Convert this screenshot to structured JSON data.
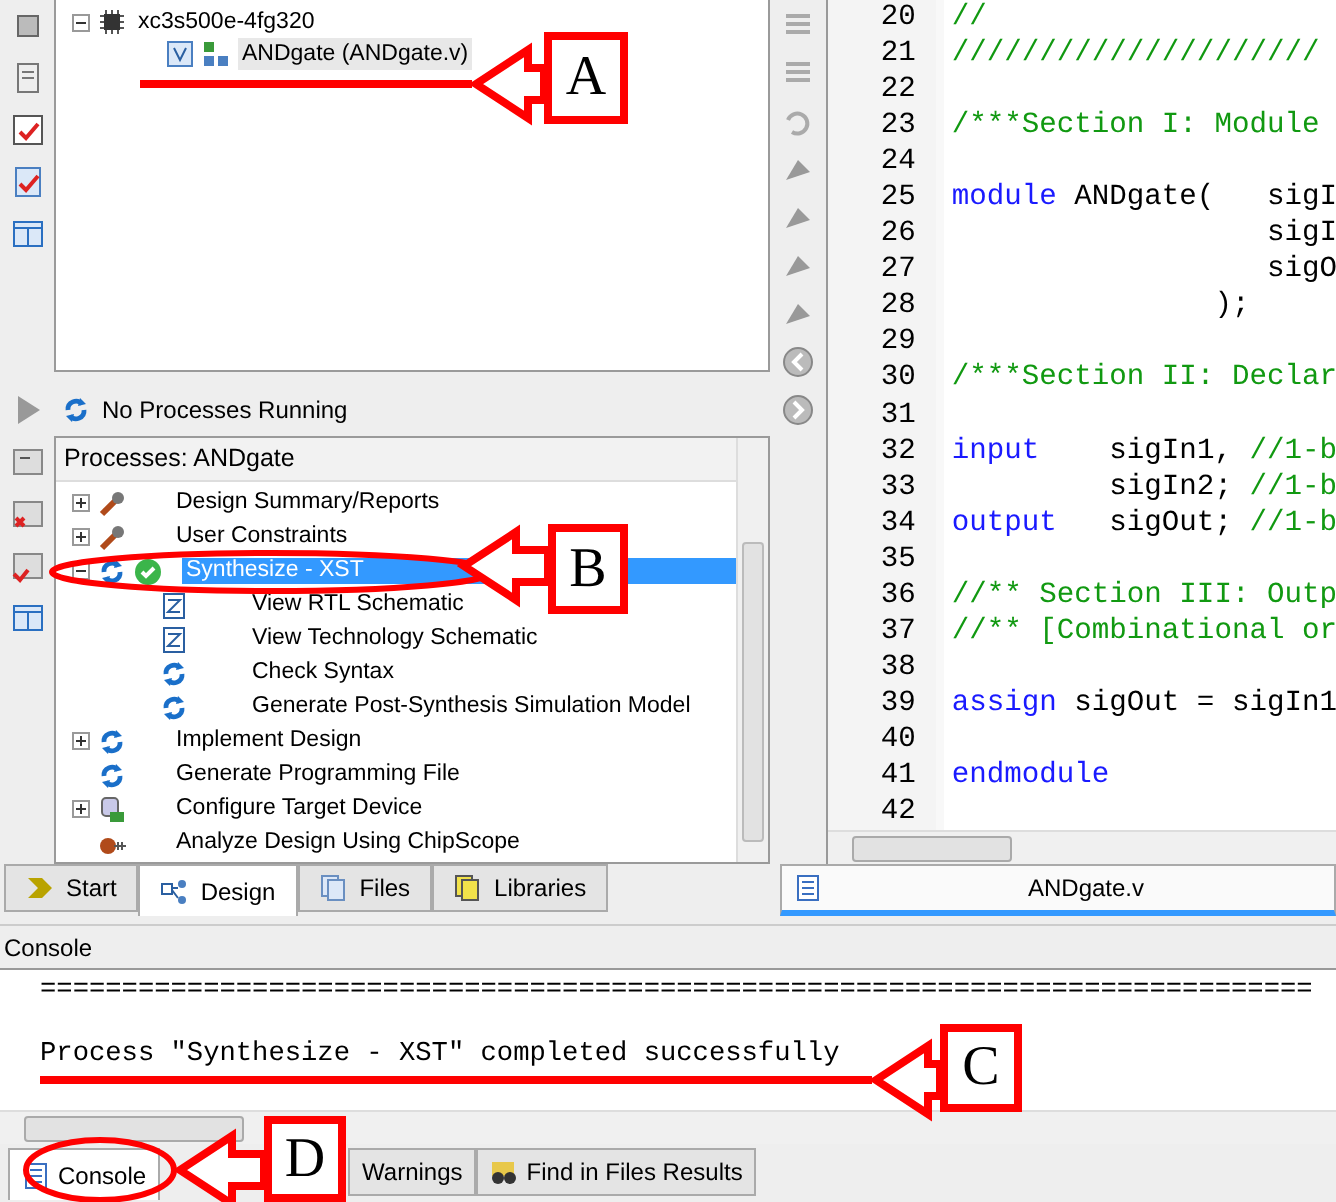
{
  "project_tree": [
    {
      "label": "xc3s500e-4fg320",
      "kind": "device",
      "expanded": true,
      "selected": false,
      "children": [
        {
          "label": "ANDgate (ANDgate.v)",
          "kind": "module",
          "selected": true
        }
      ]
    }
  ],
  "processes": {
    "status": "No Processes Running",
    "title": "Processes: ANDgate",
    "items": [
      {
        "label": "Design Summary/Reports",
        "kind": "tool",
        "expanded": false,
        "selected": false,
        "completed": false
      },
      {
        "label": "User Constraints",
        "kind": "tool",
        "expanded": false,
        "selected": false,
        "completed": false
      },
      {
        "label": "Synthesize - XST",
        "kind": "process",
        "expanded": true,
        "selected": true,
        "completed": true,
        "children": [
          {
            "label": "View RTL Schematic",
            "kind": "schematic",
            "selected": false
          },
          {
            "label": "View Technology Schematic",
            "kind": "schematic",
            "selected": false
          },
          {
            "label": "Check Syntax",
            "kind": "process",
            "selected": false
          },
          {
            "label": "Generate Post-Synthesis Simulation Model",
            "kind": "process",
            "selected": false
          }
        ]
      },
      {
        "label": "Implement Design",
        "kind": "process",
        "expanded": false,
        "selected": false,
        "completed": false
      },
      {
        "label": "Generate Programming File",
        "kind": "process",
        "selected": false,
        "completed": false
      },
      {
        "label": "Configure Target Device",
        "kind": "device",
        "expanded": false,
        "selected": false,
        "completed": false
      },
      {
        "label": "Analyze Design Using ChipScope",
        "kind": "probe",
        "selected": false,
        "completed": false
      }
    ]
  },
  "left_tabs": [
    {
      "label": "Start",
      "kind": "start",
      "selected": false
    },
    {
      "label": "Design",
      "kind": "design",
      "selected": true
    },
    {
      "label": "Files",
      "kind": "files",
      "selected": false
    },
    {
      "label": "Libraries",
      "kind": "libraries",
      "selected": false
    }
  ],
  "editor": {
    "lines": [
      {
        "number": "20",
        "tokens": [
          {
            "kind": "comment",
            "text": "//"
          }
        ]
      },
      {
        "number": "21",
        "tokens": [
          {
            "kind": "comment",
            "text": "/////////////////////"
          }
        ]
      },
      {
        "number": "22"
      },
      {
        "number": "23",
        "tokens": [
          {
            "kind": "comment",
            "text": "/***Section I: Module"
          }
        ]
      },
      {
        "number": "24"
      },
      {
        "number": "25",
        "tokens": [
          {
            "kind": "keyword",
            "text": "module"
          },
          {
            "kind": "plain",
            "text": " ANDgate(   sigI"
          }
        ]
      },
      {
        "number": "26",
        "tokens": [
          {
            "kind": "plain",
            "text": "                  sigI"
          }
        ]
      },
      {
        "number": "27",
        "tokens": [
          {
            "kind": "plain",
            "text": "                  sigO"
          }
        ]
      },
      {
        "number": "28",
        "tokens": [
          {
            "kind": "plain",
            "text": "               );"
          }
        ]
      },
      {
        "number": "29"
      },
      {
        "number": "30",
        "tokens": [
          {
            "kind": "comment",
            "text": "/***Section II: Declar"
          }
        ]
      },
      {
        "number": "31"
      },
      {
        "number": "32",
        "tokens": [
          {
            "kind": "keyword",
            "text": "input"
          },
          {
            "kind": "plain",
            "text": "    sigIn1, "
          },
          {
            "kind": "comment",
            "text": "//1-b"
          }
        ]
      },
      {
        "number": "33",
        "tokens": [
          {
            "kind": "plain",
            "text": "         sigIn2; "
          },
          {
            "kind": "comment",
            "text": "//1-b"
          }
        ]
      },
      {
        "number": "34",
        "tokens": [
          {
            "kind": "keyword",
            "text": "output"
          },
          {
            "kind": "plain",
            "text": "   sigOut; "
          },
          {
            "kind": "comment",
            "text": "//1-b"
          }
        ]
      },
      {
        "number": "35"
      },
      {
        "number": "36",
        "tokens": [
          {
            "kind": "comment",
            "text": "//** Section III: Outp"
          }
        ]
      },
      {
        "number": "37",
        "tokens": [
          {
            "kind": "comment",
            "text": "//** [Combinational or"
          }
        ]
      },
      {
        "number": "38"
      },
      {
        "number": "39",
        "tokens": [
          {
            "kind": "keyword",
            "text": "assign"
          },
          {
            "kind": "plain",
            "text": " sigOut = sigIn1"
          }
        ]
      },
      {
        "number": "40"
      },
      {
        "number": "41",
        "tokens": [
          {
            "kind": "keyword",
            "text": "endmodule"
          }
        ]
      },
      {
        "number": "42"
      }
    ],
    "tab": {
      "label": "ANDgate.v",
      "selected": true
    }
  },
  "console": {
    "title": "Console",
    "lines": [
      "==============================================================================",
      "Process \"Synthesize - XST\" completed successfully"
    ]
  },
  "bottom_tabs": [
    {
      "label": "Console",
      "kind": "console",
      "selected": true
    },
    {
      "label": "Warnings",
      "kind": "warnings",
      "selected": false
    },
    {
      "label": "Find in Files Results",
      "kind": "find",
      "selected": false
    }
  ],
  "annotations": [
    {
      "label": "A",
      "kind": "underline"
    },
    {
      "label": "B",
      "kind": "ellipse"
    },
    {
      "label": "C",
      "kind": "underline"
    },
    {
      "label": "D",
      "kind": "ellipse"
    }
  ]
}
